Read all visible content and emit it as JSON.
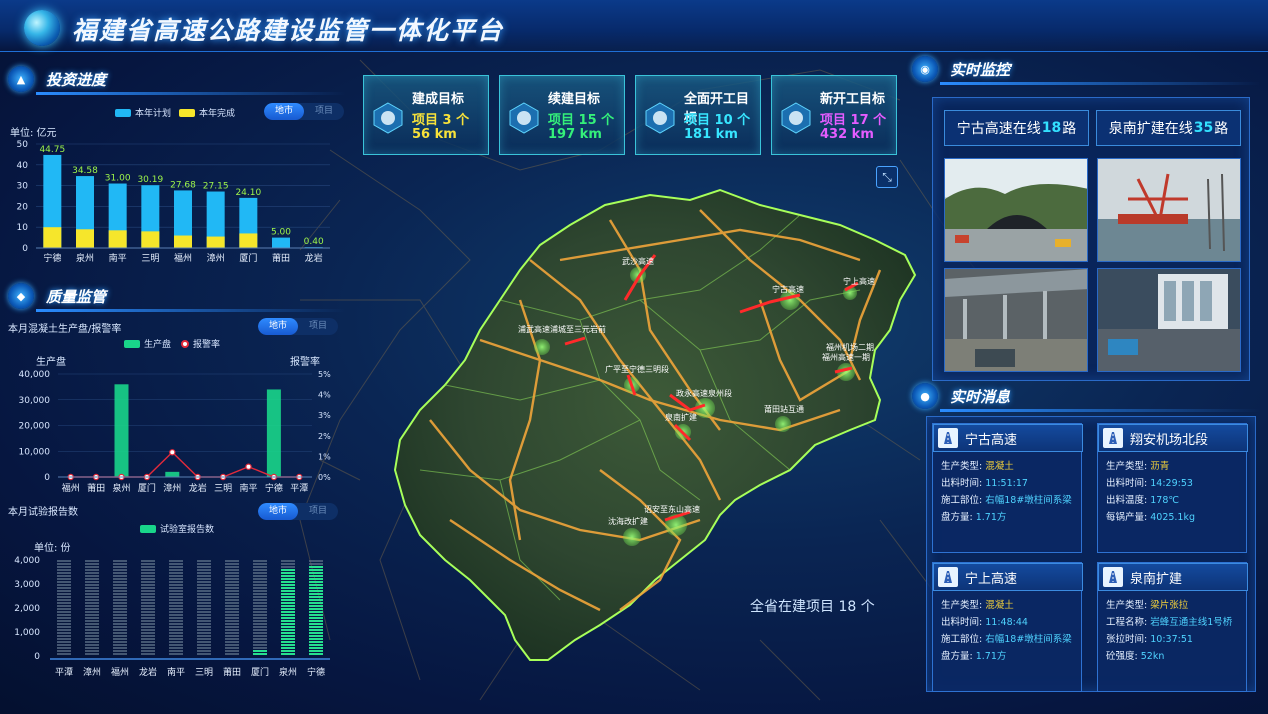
{
  "header": {
    "title": "福建省高速公路建设监管一体化平台"
  },
  "investment": {
    "section_title": "投资进度",
    "toggle": [
      "地市",
      "项目"
    ],
    "unit_label": "单位: 亿元",
    "legend": [
      {
        "name": "本年计划",
        "color": "#21b8f5"
      },
      {
        "name": "本年完成",
        "color": "#f6e62b"
      }
    ]
  },
  "quality": {
    "section_title": "质量监管",
    "concrete_title": "本月混凝土生产盘/报警率",
    "toggle": [
      "地市",
      "项目"
    ],
    "left_axis_label": "生产盘",
    "right_axis_label": "报警率",
    "legend": [
      {
        "name": "生产盘",
        "color": "#19d58a"
      },
      {
        "name": "报警率",
        "color": "#e12a3b"
      }
    ],
    "report_title": "本月试验报告数",
    "report_toggle": [
      "地市",
      "项目"
    ],
    "report_legend": "试验室报告数",
    "report_unit": "单位: 份"
  },
  "targets": [
    {
      "title": "建成目标",
      "count_label": "项目",
      "count": "3",
      "count_unit": "个",
      "length": "56",
      "length_unit": "km",
      "color": "#f7e13a"
    },
    {
      "title": "续建目标",
      "count_label": "项目",
      "count": "15",
      "count_unit": "个",
      "length": "197",
      "length_unit": "km",
      "color": "#34f07a"
    },
    {
      "title": "全面开工目标",
      "count_label": "项目",
      "count": "10",
      "count_unit": "个",
      "length": "181",
      "length_unit": "km",
      "color": "#37e6ff"
    },
    {
      "title": "新开工目标",
      "count_label": "项目",
      "count": "17",
      "count_unit": "个",
      "length": "432",
      "length_unit": "km",
      "color": "#e45cff"
    }
  ],
  "map": {
    "total_text": "全省在建项目 18 个",
    "labels": [
      "武沙高速",
      "宁古高速",
      "宁上高速",
      "浦武高速浦城至三元岩前",
      "广平至宁德三明段",
      "政永高速泉州段",
      "泉南扩建",
      "莆田站互通",
      "福州机场二期",
      "福州高速一期",
      "诏安至东山高速",
      "沈海改扩建"
    ]
  },
  "monitor": {
    "section_title": "实时监控",
    "online": [
      {
        "name": "宁古高速在线",
        "count": "18",
        "suffix": "路"
      },
      {
        "name": "泉南扩建在线",
        "count": "35",
        "suffix": "路"
      }
    ],
    "cameras": [
      "tunnel-site",
      "bridge-crane",
      "plant-interior",
      "mixing-station"
    ]
  },
  "messages": {
    "section_title": "实时消息",
    "items": [
      {
        "name": "宁古高速",
        "rows": [
          {
            "k": "生产类型:",
            "v": "混凝土",
            "style": "v"
          },
          {
            "k": "出料时间:",
            "v": "11:51:17",
            "style": "c"
          },
          {
            "k": "施工部位:",
            "v": "右幅18#墩柱间系梁",
            "style": "c"
          },
          {
            "k": "盘方量:",
            "v": "1.71方",
            "style": "c"
          }
        ]
      },
      {
        "name": "翔安机场北段",
        "rows": [
          {
            "k": "生产类型:",
            "v": "沥青",
            "style": "v"
          },
          {
            "k": "出料时间:",
            "v": "14:29:53",
            "style": "c"
          },
          {
            "k": "出料温度:",
            "v": "178℃",
            "style": "c"
          },
          {
            "k": "每锅产量:",
            "v": "4025.1kg",
            "style": "c"
          }
        ]
      },
      {
        "name": "宁上高速",
        "rows": [
          {
            "k": "生产类型:",
            "v": "混凝土",
            "style": "v"
          },
          {
            "k": "出料时间:",
            "v": "11:48:44",
            "style": "c"
          },
          {
            "k": "施工部位:",
            "v": "右幅18#墩柱间系梁",
            "style": "c"
          },
          {
            "k": "盘方量:",
            "v": "1.71方",
            "style": "c"
          }
        ]
      },
      {
        "name": "泉南扩建",
        "rows": [
          {
            "k": "生产类型:",
            "v": "梁片张拉",
            "style": "v"
          },
          {
            "k": "工程名称:",
            "v": "岩蜂互通主线1号桥",
            "style": "c"
          },
          {
            "k": "张拉时间:",
            "v": "10:37:51",
            "style": "c"
          },
          {
            "k": "砼强度:",
            "v": "52kn",
            "style": "c"
          }
        ]
      }
    ]
  },
  "chart_data": [
    {
      "type": "bar",
      "title": "投资进度",
      "ylabel": "单位: 亿元",
      "categories": [
        "宁德",
        "泉州",
        "南平",
        "三明",
        "福州",
        "漳州",
        "厦门",
        "莆田",
        "龙岩"
      ],
      "series": [
        {
          "name": "本年计划",
          "values": [
            44.75,
            34.58,
            31.0,
            30.19,
            27.68,
            27.15,
            24.1,
            5.0,
            0.4
          ]
        },
        {
          "name": "本年完成",
          "values": [
            10,
            9,
            8.5,
            8,
            6,
            5.5,
            7,
            0,
            0
          ]
        }
      ],
      "ylim": [
        0,
        50
      ],
      "yticks": [
        0,
        10,
        20,
        30,
        40,
        50
      ]
    },
    {
      "type": "bar",
      "title": "本月混凝土生产盘/报警率",
      "categories": [
        "福州",
        "莆田",
        "泉州",
        "厦门",
        "漳州",
        "龙岩",
        "三明",
        "南平",
        "宁德",
        "平潭"
      ],
      "series": [
        {
          "name": "生产盘",
          "values": [
            0,
            0,
            36000,
            0,
            2000,
            0,
            0,
            0,
            34000,
            0
          ]
        },
        {
          "name": "报警率",
          "values": [
            0,
            0,
            0,
            0,
            1.2,
            0,
            0,
            0.5,
            0,
            0
          ]
        }
      ],
      "ylim": [
        0,
        40000
      ],
      "yticks": [
        "0",
        "10,000",
        "20,000",
        "30,000",
        "40,000"
      ],
      "y2lim": [
        0,
        5
      ],
      "y2ticks": [
        "0%",
        "1%",
        "2%",
        "3%",
        "4%",
        "5%"
      ]
    },
    {
      "type": "bar",
      "title": "本月试验报告数",
      "categories": [
        "平潭",
        "漳州",
        "福州",
        "龙岩",
        "南平",
        "三明",
        "莆田",
        "厦门",
        "泉州",
        "宁德"
      ],
      "series": [
        {
          "name": "试验室报告数",
          "values": [
            10,
            10,
            10,
            50,
            20,
            30,
            70,
            250,
            3650,
            3850
          ]
        }
      ],
      "ylim": [
        0,
        4000
      ],
      "yticks": [
        "0",
        "1,000",
        "2,000",
        "3,000",
        "4,000"
      ]
    }
  ]
}
